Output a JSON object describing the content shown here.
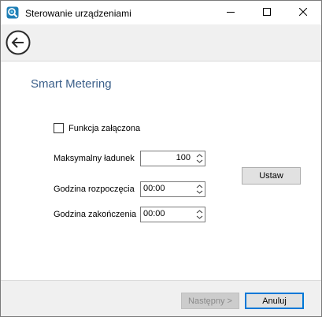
{
  "window": {
    "title": "Sterowanie urządzeniami"
  },
  "icons": {
    "app": "app-logo-icon",
    "minimize": "minimize-icon",
    "maximize": "maximize-icon",
    "close": "close-icon",
    "back": "back-arrow-icon",
    "spin": "spin-arrows-icon"
  },
  "page": {
    "title": "Smart Metering"
  },
  "form": {
    "enabled": {
      "label": "Funkcja załączona",
      "checked": false
    },
    "max_load": {
      "label": "Maksymalny ładunek",
      "value": "100"
    },
    "start_time": {
      "label": "Godzina rozpoczęcia",
      "value": "00:00"
    },
    "end_time": {
      "label": "Godzina zakończenia",
      "value": "00:00"
    },
    "set_button": "Ustaw"
  },
  "footer": {
    "next_label": "Następny >",
    "cancel_label": "Anuluj"
  },
  "colors": {
    "title_accent": "#3b5f8a",
    "focus_border": "#0078d7"
  }
}
